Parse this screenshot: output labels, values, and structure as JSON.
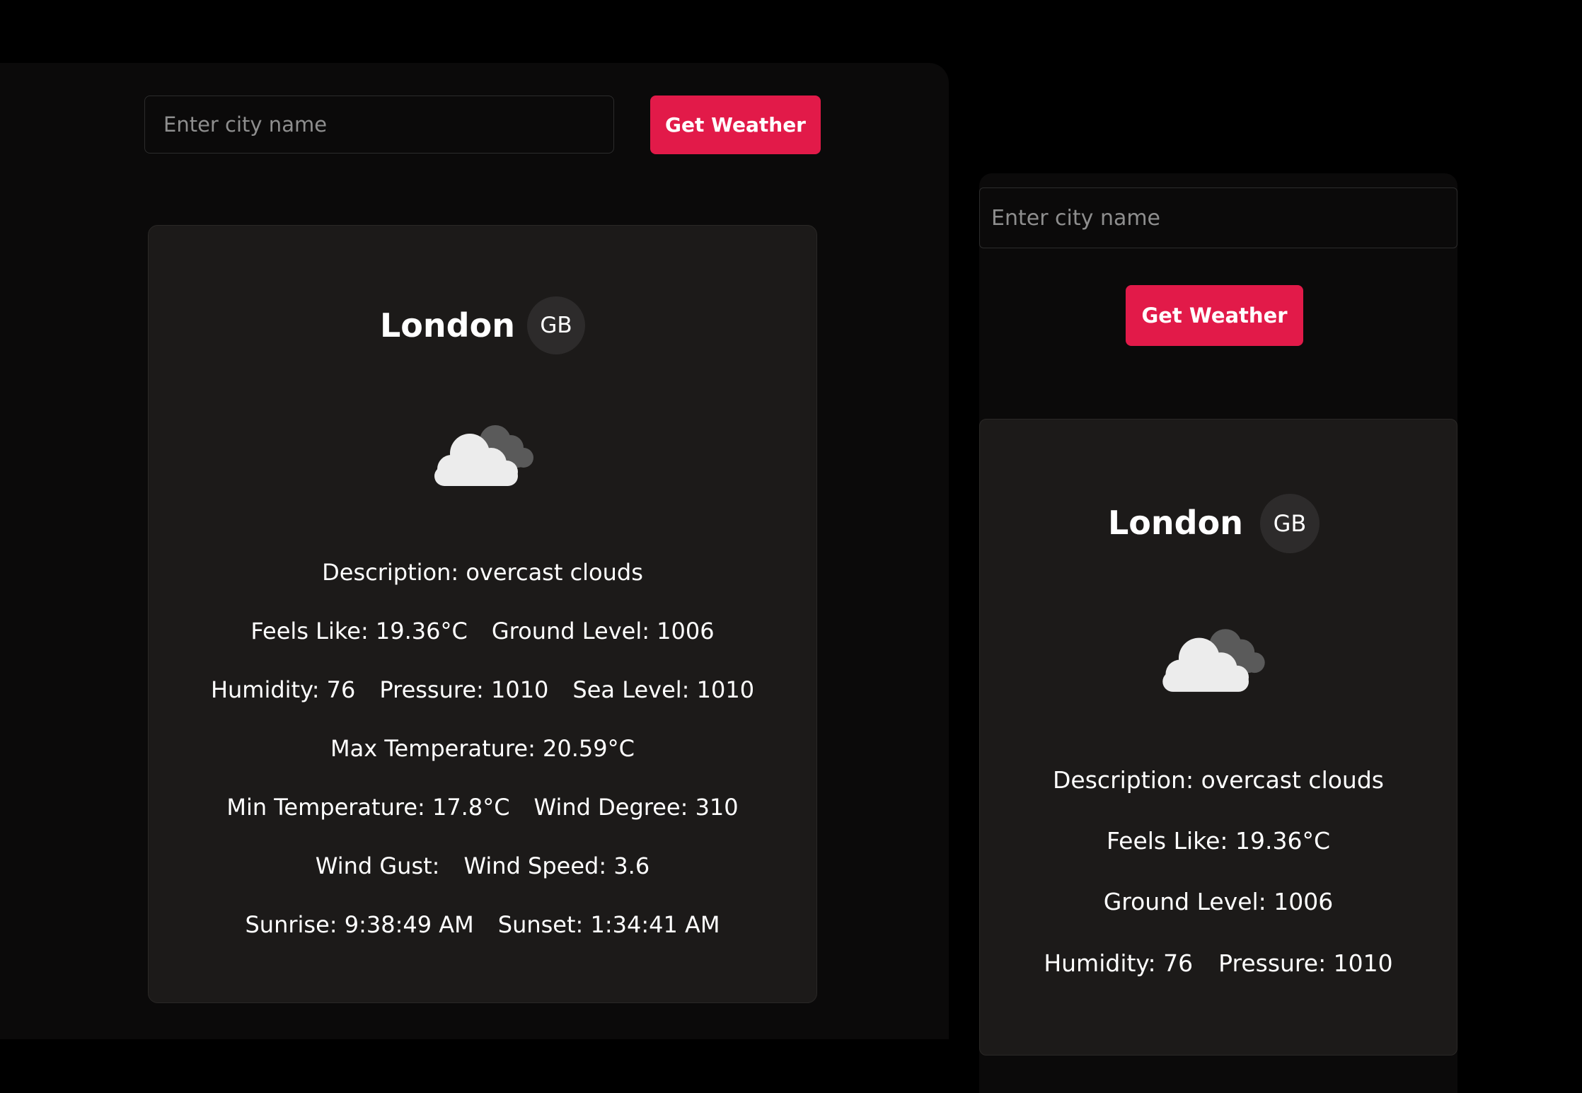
{
  "search": {
    "placeholder": "Enter city name",
    "button_label": "Get Weather"
  },
  "weather": {
    "city": "London",
    "country": "GB",
    "icon": "overcast-clouds-icon",
    "description": "Description: overcast clouds",
    "feels_like": "Feels Like: 19.36°C",
    "ground_level": "Ground Level: 1006",
    "humidity": "Humidity: 76",
    "pressure": "Pressure: 1010",
    "sea_level": "Sea Level: 1010",
    "max_temp": "Max Temperature: 20.59°C",
    "min_temp": "Min Temperature: 17.8°C",
    "wind_degree": "Wind Degree: 310",
    "wind_gust": "Wind Gust:",
    "wind_speed": "Wind Speed: 3.6",
    "sunrise": "Sunrise: 9:38:49 AM",
    "sunset": "Sunset: 1:34:41 AM"
  },
  "colors": {
    "accent": "#e21a49",
    "card": "#1c1a19",
    "panel": "#0b0a0a",
    "background": "#000000"
  }
}
